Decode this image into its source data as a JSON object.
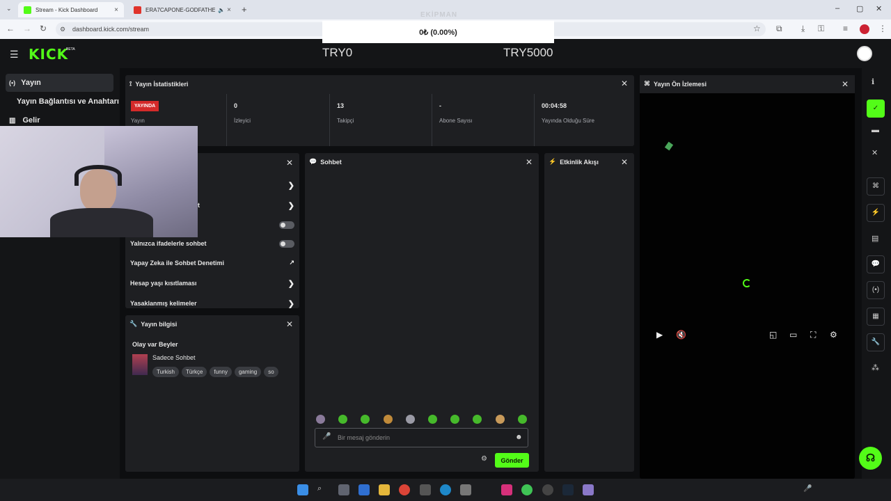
{
  "browser": {
    "tabs": [
      {
        "title": "Stream - Kick Dashboard",
        "active": true,
        "color": "#53fc18"
      },
      {
        "title": "ERA7CAPONE-GODFATHER",
        "active": false,
        "color": "#e0332b"
      }
    ],
    "url": "dashboard.kick.com/stream"
  },
  "overlay": {
    "donation_text": "0₺ (0.00%)",
    "ekipman_label": "EKİPMAN"
  },
  "header": {
    "logo": "KICK",
    "logo_badge": "BETA",
    "goal_left": "TRY0",
    "goal_right": "TRY5000"
  },
  "sidebar": {
    "items": [
      {
        "label": "Yayın",
        "icon": "broadcast-icon"
      },
      {
        "label": "Yayın Bağlantısı ve Anahtarı",
        "icon": ""
      },
      {
        "label": "Gelir",
        "icon": "chart-icon"
      }
    ]
  },
  "stats": {
    "title": "Yayın İstatistikleri",
    "badge": "YAYINDA",
    "items": [
      {
        "value": "",
        "label": "Yayın"
      },
      {
        "value": "0",
        "label": "İzleyici"
      },
      {
        "value": "13",
        "label": "Takipçi"
      },
      {
        "value": "-",
        "label": "Abone Sayısı"
      },
      {
        "value": "00:04:58",
        "label": "Yayında Olduğu Süre"
      }
    ]
  },
  "preview": {
    "title": "Yayın Ön İzlemesi"
  },
  "settings": {
    "rows": [
      {
        "label": "",
        "control": "chevron"
      },
      {
        "label": "et",
        "control": "chevron"
      },
      {
        "label": "t",
        "control": "toggle"
      },
      {
        "label": "Yalnızca ifadelerle sohbet",
        "control": "toggle"
      },
      {
        "label": "Yapay Zeka ile Sohbet Denetimi",
        "control": "external"
      },
      {
        "label": "Hesap yaşı kısıtlaması",
        "control": "chevron"
      },
      {
        "label": "Yasaklanmış kelimeler",
        "control": "chevron"
      }
    ]
  },
  "info": {
    "title": "Yayın bilgisi",
    "stream_title": "Olay var Beyler",
    "category": "Sadece Sohbet",
    "tags": [
      "Turkish",
      "Türkçe",
      "funny",
      "gaming",
      "so"
    ]
  },
  "chat": {
    "title": "Sohbet",
    "placeholder": "Bir mesaj gönderin",
    "send": "Gönder"
  },
  "events": {
    "title": "Etkinlik Akışı"
  },
  "colors": {
    "brand": "#53fc18",
    "live": "#d42a2a"
  }
}
